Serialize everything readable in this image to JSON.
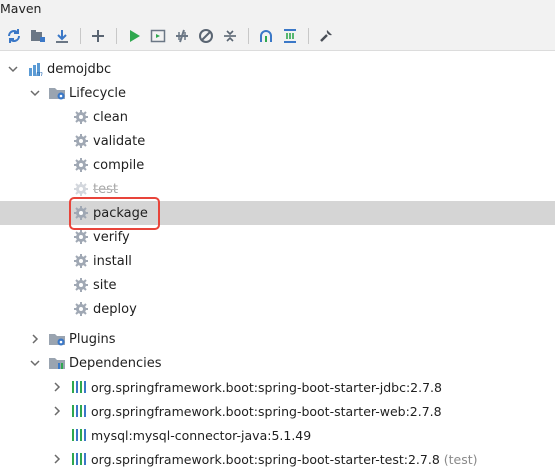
{
  "window": {
    "title": "Maven"
  },
  "toolbar": {
    "buttons": [
      {
        "name": "reload-icon"
      },
      {
        "name": "generate-sources-icon"
      },
      {
        "name": "download-icon"
      },
      {
        "name": "add-icon"
      },
      {
        "name": "run-icon"
      },
      {
        "name": "execute-goal-icon"
      },
      {
        "name": "toggle-offline-icon"
      },
      {
        "name": "skip-tests-icon"
      },
      {
        "name": "collapse-icon"
      },
      {
        "name": "show-dependencies-icon"
      },
      {
        "name": "analyze-icon"
      },
      {
        "name": "settings-wrench-icon"
      }
    ]
  },
  "tree": {
    "project": "demojdbc",
    "lifecycle": {
      "label": "Lifecycle",
      "goals": [
        "clean",
        "validate",
        "compile",
        "test",
        "package",
        "verify",
        "install",
        "site",
        "deploy"
      ],
      "selected": "package",
      "dimmed": "test"
    },
    "plugins": {
      "label": "Plugins"
    },
    "dependencies": {
      "label": "Dependencies",
      "items": [
        {
          "label": "org.springframework.boot:spring-boot-starter-jdbc:2.7.8",
          "expandable": true,
          "scope": ""
        },
        {
          "label": "org.springframework.boot:spring-boot-starter-web:2.7.8",
          "expandable": true,
          "scope": ""
        },
        {
          "label": "mysql:mysql-connector-java:5.1.49",
          "expandable": false,
          "scope": ""
        },
        {
          "label": "org.springframework.boot:spring-boot-starter-test:2.7.8",
          "expandable": true,
          "scope": "(test)"
        }
      ]
    }
  },
  "colors": {
    "selection": "#d5d5d5",
    "highlight": "#e8443a",
    "run_green": "#2fa84f",
    "folder_blue": "#5b9bd5",
    "gear_gray": "#a0a8b4"
  }
}
